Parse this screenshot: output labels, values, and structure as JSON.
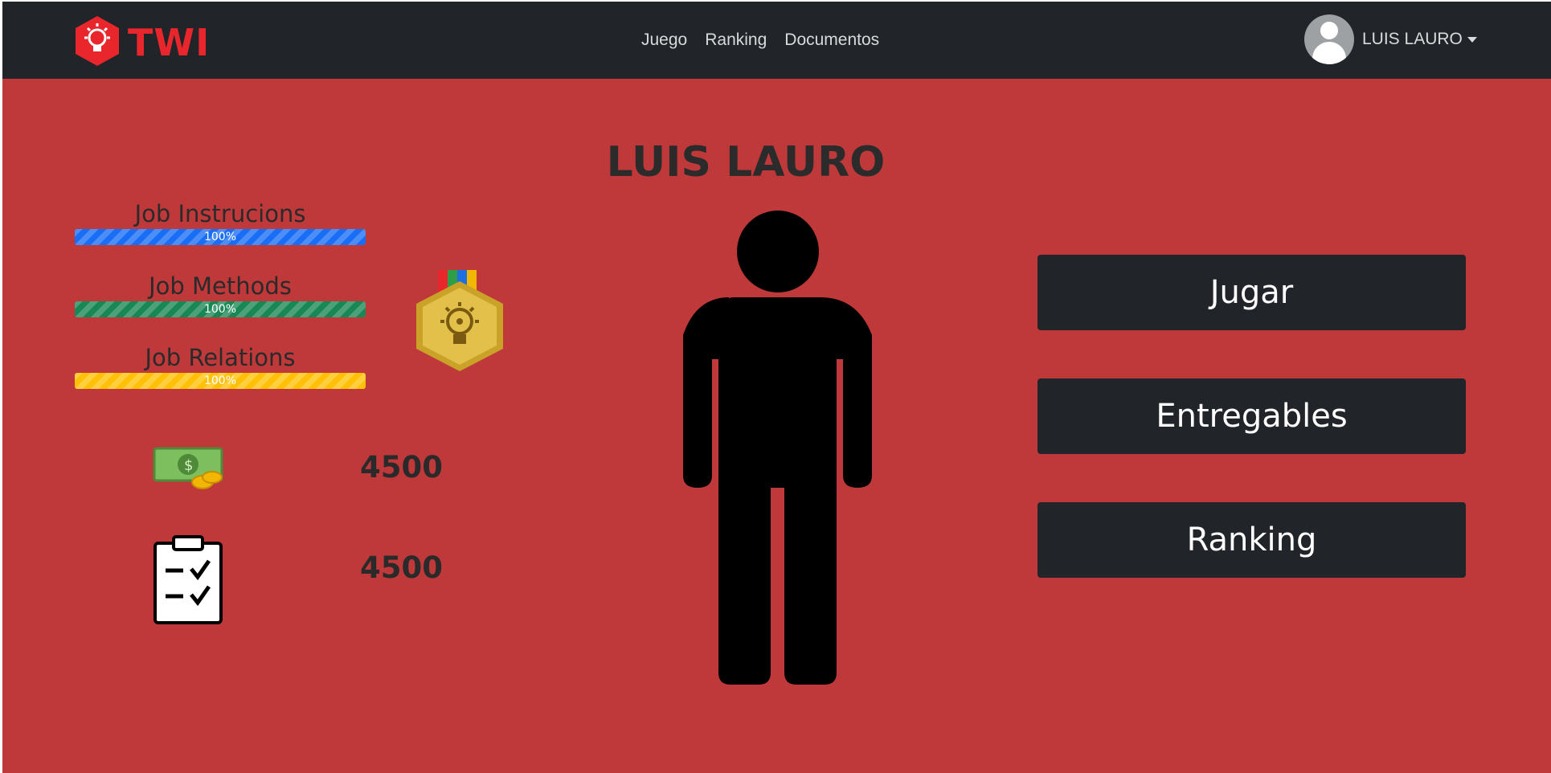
{
  "header": {
    "logo_text": "TWI",
    "nav": [
      "Juego",
      "Ranking",
      "Documentos"
    ],
    "user_name": "LUIS LAURO"
  },
  "profile": {
    "name": "LUIS LAURO",
    "skills": [
      {
        "label": "Job Instrucions",
        "progress_text": "100%",
        "progress": 1.0,
        "color": "#1a6ef5"
      },
      {
        "label": "Job Methods",
        "progress_text": "100%",
        "progress": 1.0,
        "color": "#198754"
      },
      {
        "label": "Job Relations",
        "progress_text": "100%",
        "progress": 1.0,
        "color": "#ffc107"
      }
    ],
    "stats": {
      "money": "4500",
      "tasks": "4500"
    }
  },
  "actions": {
    "play_label": "Jugar",
    "deliverables_label": "Entregables",
    "ranking_label": "Ranking"
  },
  "colors": {
    "background": "#c0393a",
    "navbar": "#212529",
    "brand": "#e8262c",
    "button": "#212529"
  }
}
